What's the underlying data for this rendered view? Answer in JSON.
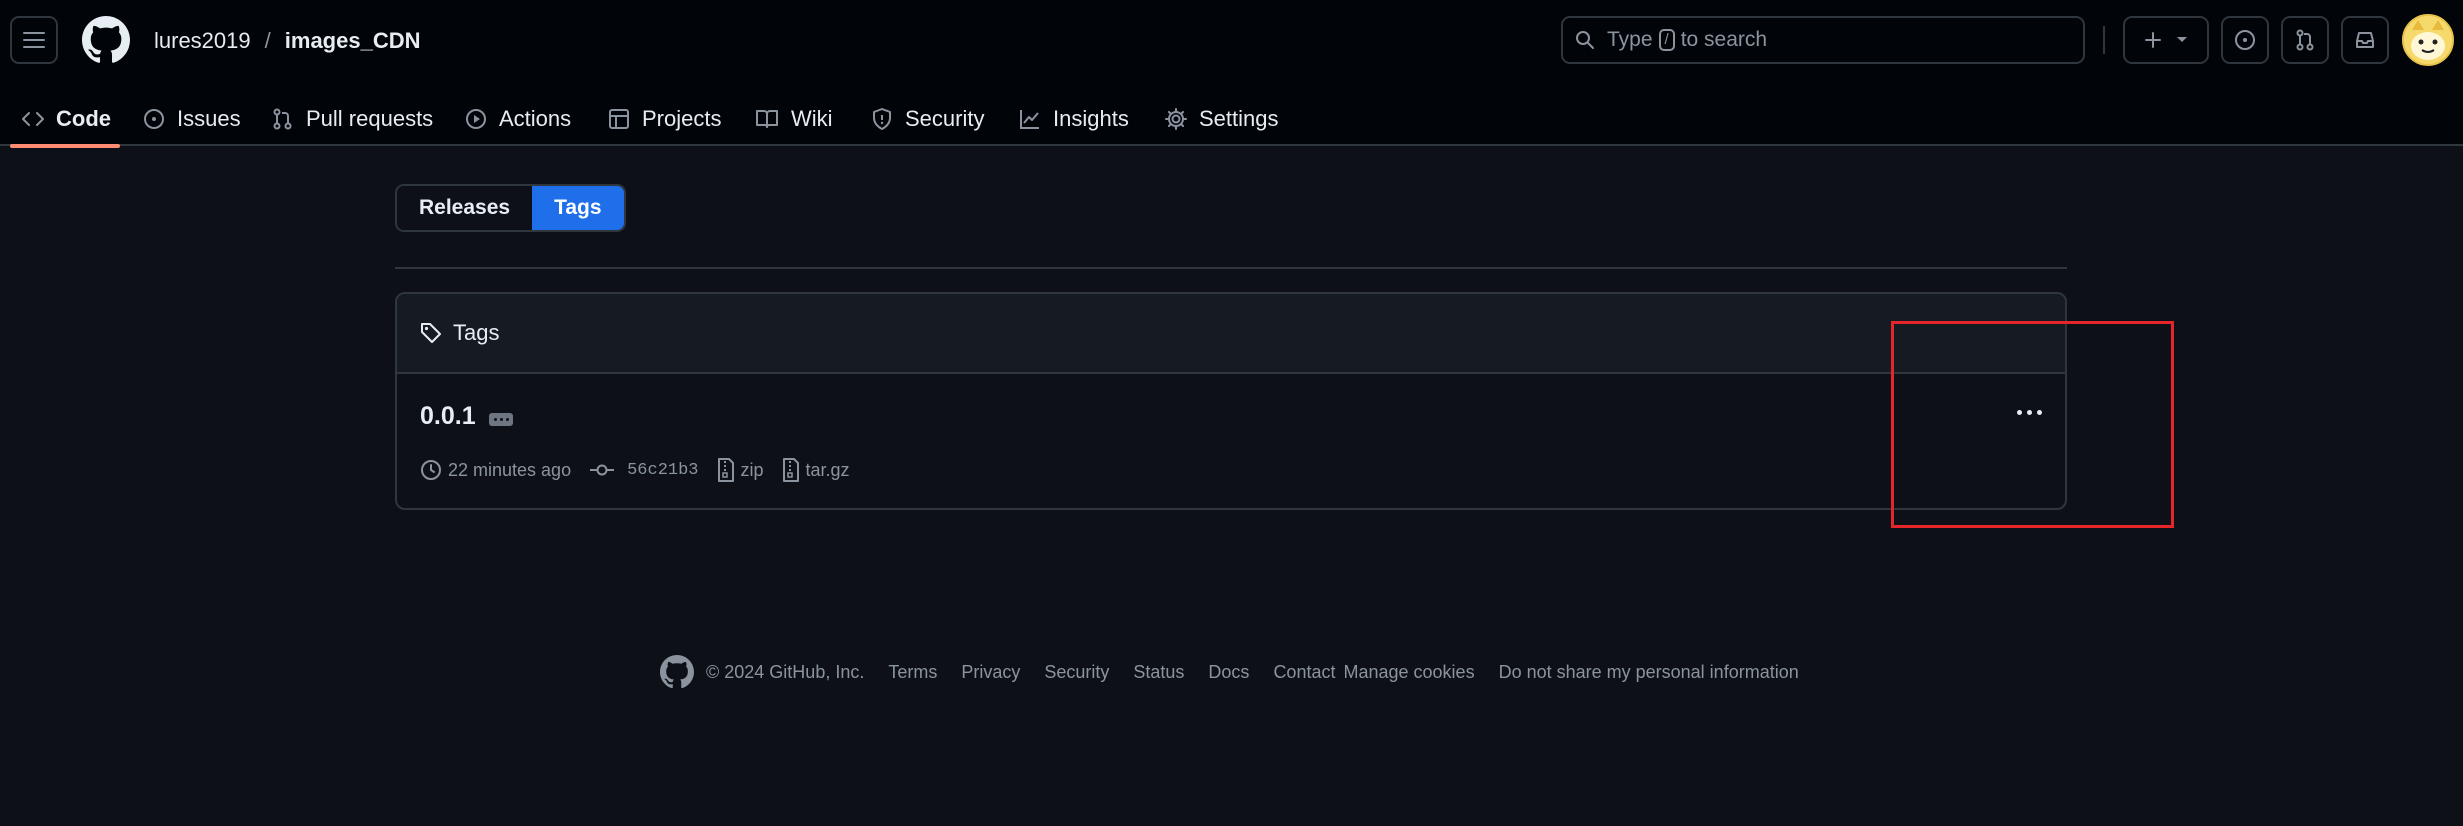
{
  "header": {
    "owner": "lures2019",
    "separator": "/",
    "repo": "images_CDN",
    "search": {
      "prefix": "Type",
      "key": "/",
      "suffix": "to search"
    }
  },
  "tabs": [
    {
      "label": "Code",
      "icon": "code-icon",
      "active": true
    },
    {
      "label": "Issues",
      "icon": "issue-icon"
    },
    {
      "label": "Pull requests",
      "icon": "pull-request-icon"
    },
    {
      "label": "Actions",
      "icon": "play-icon"
    },
    {
      "label": "Projects",
      "icon": "table-icon"
    },
    {
      "label": "Wiki",
      "icon": "book-icon"
    },
    {
      "label": "Security",
      "icon": "shield-icon"
    },
    {
      "label": "Insights",
      "icon": "graph-icon"
    },
    {
      "label": "Settings",
      "icon": "gear-icon"
    }
  ],
  "toggle": {
    "releases": "Releases",
    "tags": "Tags",
    "selected": "Tags"
  },
  "tags_box": {
    "heading": "Tags",
    "items": [
      {
        "name": "0.0.1",
        "time": "22 minutes ago",
        "commit": "56c21b3",
        "zip": "zip",
        "targz": "tar.gz"
      }
    ]
  },
  "footer": {
    "copyright": "© 2024 GitHub, Inc.",
    "links": [
      "Terms",
      "Privacy",
      "Security",
      "Status",
      "Docs",
      "Contact",
      "Manage cookies",
      "Do not share my personal information"
    ]
  },
  "colors": {
    "background": "#0d1117",
    "header_bg": "#010409",
    "accent_blue": "#1f6feb",
    "tab_underline": "#fd8c73",
    "highlight_box": "#e5252a"
  }
}
